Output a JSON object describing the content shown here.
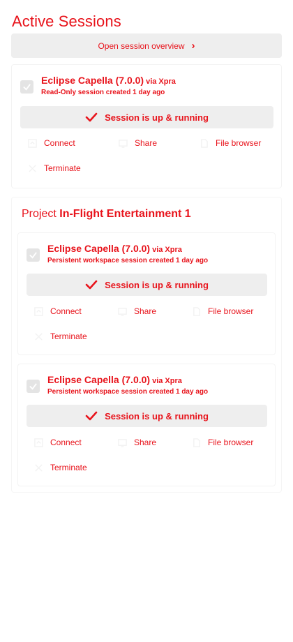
{
  "page": {
    "title": "Active Sessions"
  },
  "overview_button": {
    "label": "Open session overview"
  },
  "sessions_top": [
    {
      "name": "Eclipse Capella (7.0.0)",
      "via": "via Xpra",
      "description": "Read-Only session created 1 day ago",
      "status": "Session is up & running",
      "actions": {
        "connect": "Connect",
        "share": "Share",
        "files": "File browser",
        "terminate": "Terminate"
      }
    }
  ],
  "project": {
    "title_prefix": "Project",
    "title_name": "In-Flight Entertainment 1",
    "sessions": [
      {
        "name": "Eclipse Capella (7.0.0)",
        "via": "via Xpra",
        "description": "Persistent workspace session created 1 day ago",
        "status": "Session is up & running",
        "actions": {
          "connect": "Connect",
          "share": "Share",
          "files": "File browser",
          "terminate": "Terminate"
        }
      },
      {
        "name": "Eclipse Capella (7.0.0)",
        "via": "via Xpra",
        "description": "Persistent workspace session created 1 day ago",
        "status": "Session is up & running",
        "actions": {
          "connect": "Connect",
          "share": "Share",
          "files": "File browser",
          "terminate": "Terminate"
        }
      }
    ]
  },
  "icons": {
    "chevron": "chevron-right-icon",
    "checkbox": "checkbox-icon",
    "status": "check-icon",
    "connect": "open-in-window-icon",
    "share": "share-screen-icon",
    "files": "file-icon",
    "terminate": "close-icon"
  },
  "colors": {
    "accent": "#e8141c",
    "button_bg": "#eeeeee",
    "checkbox_bg": "#e4e4e4"
  }
}
